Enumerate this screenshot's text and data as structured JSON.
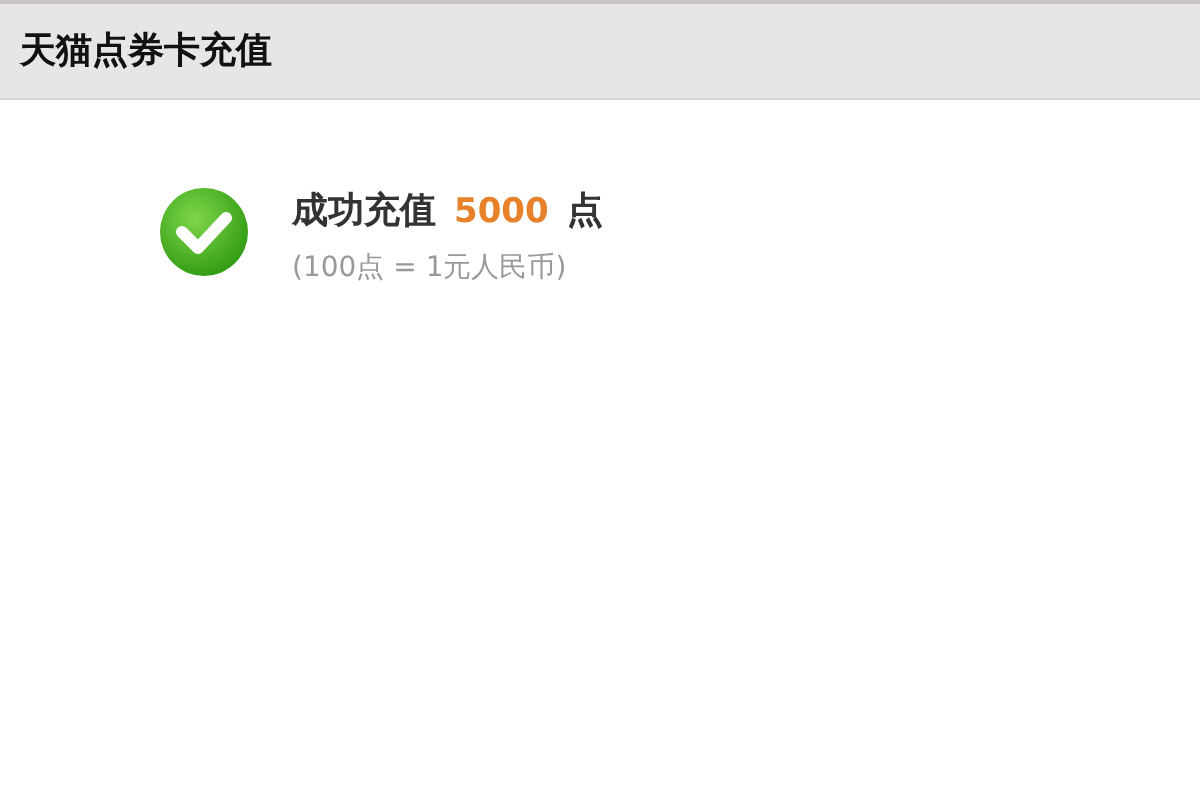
{
  "header": {
    "title": "天猫点券卡充值"
  },
  "result": {
    "success": true,
    "message": "成功充值",
    "amount": "5000",
    "unit": "点",
    "note": "(100点 = 1元人民币)"
  }
}
